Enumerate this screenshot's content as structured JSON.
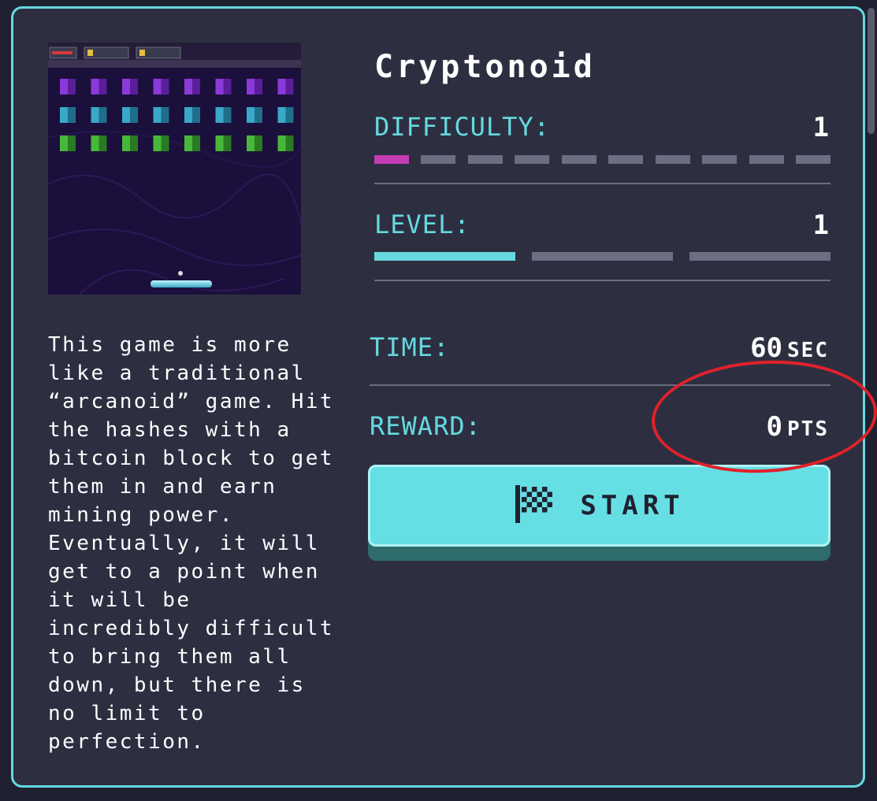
{
  "game": {
    "title": "Cryptonoid",
    "description": "This game is more\nlike a traditional\n“arcanoid” game. Hit\nthe hashes with a\nbitcoin block to get\nthem in and earn\nmining power.\nEventually, it will\nget to a point when\nit will be\nincredibly difficult\nto bring them all\ndown, but there is\nno limit to\nperfection."
  },
  "difficulty": {
    "label": "DIFFICULTY:",
    "value": "1",
    "max": 10,
    "active_color": "#c63cb4"
  },
  "level": {
    "label": "LEVEL:",
    "value": "1",
    "max": 3,
    "active_color": "#66d9df"
  },
  "time": {
    "label": "TIME:",
    "value": "60",
    "unit": "SEC"
  },
  "reward": {
    "label": "REWARD:",
    "value": "0",
    "unit": "PTS"
  },
  "start_button": {
    "label": "START",
    "icon": "checkered-flag-icon"
  },
  "colors": {
    "accent": "#66d9df",
    "card_bg": "#2d2f41",
    "annotation": "#e0212a"
  }
}
